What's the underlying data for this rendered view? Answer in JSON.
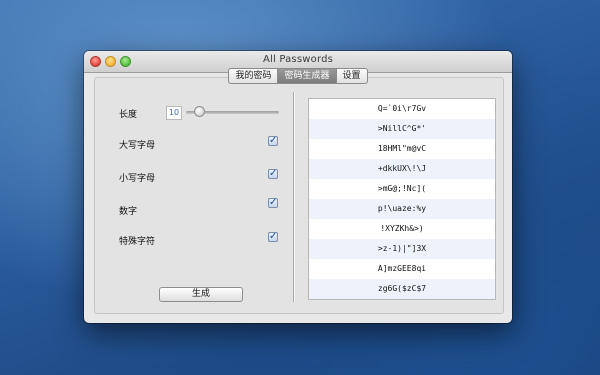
{
  "window": {
    "title": "All Passwords"
  },
  "tabs": [
    {
      "label": "我的密码",
      "active": false
    },
    {
      "label": "密码生成器",
      "active": true
    },
    {
      "label": "设置",
      "active": false
    }
  ],
  "settings": {
    "length_label": "长度",
    "length_value": "10",
    "uppercase_label": "大写字母",
    "lowercase_label": "小写字母",
    "digits_label": "数字",
    "special_label": "特殊字符",
    "checkmark": "✓"
  },
  "generate_label": "生成",
  "passwords": [
    "Q=`0i\\r7Gv",
    ">NillC^G*'",
    "18HMl\"m@vC",
    "+dkkUX\\!\\J",
    ">mG@;!Nc](",
    "p!\\uaze:%y",
    "!XYZKh&>)",
    ">z-1)|\"]3X",
    "A]mzGEE8qi",
    "zg6G($zC$7"
  ],
  "colors": {
    "accent": "#3b6fb5",
    "active_tab": "#8a8a8a",
    "desktop": "#28599a"
  }
}
